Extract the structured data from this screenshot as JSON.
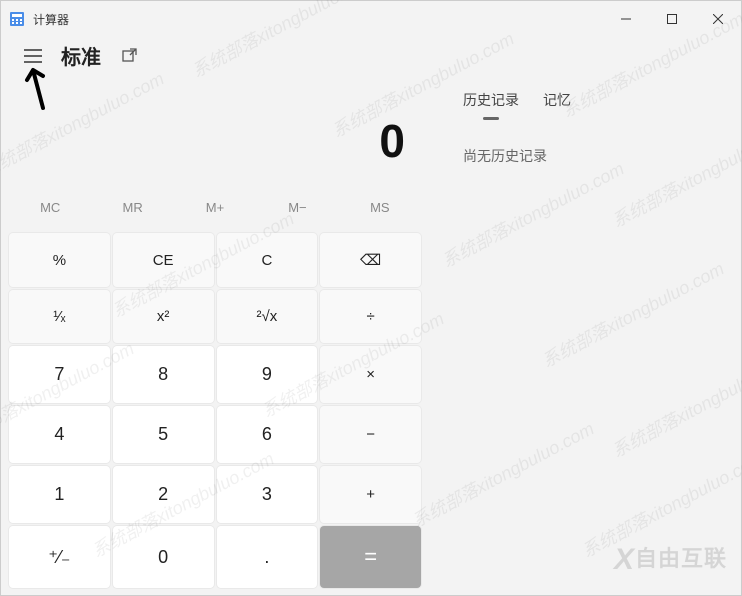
{
  "titlebar": {
    "title": "计算器"
  },
  "header": {
    "mode": "标准"
  },
  "display": {
    "value": "0"
  },
  "memory": {
    "mc": "MC",
    "mr": "MR",
    "mplus": "M+",
    "mminus": "M−",
    "ms": "MS"
  },
  "keys": {
    "percent": "%",
    "ce": "CE",
    "c": "C",
    "backspace": "⌫",
    "reciprocal": "¹⁄ₓ",
    "square": "x²",
    "sqrt": "²√x",
    "divide": "÷",
    "n7": "7",
    "n8": "8",
    "n9": "9",
    "multiply": "×",
    "n4": "4",
    "n5": "5",
    "n6": "6",
    "minus": "−",
    "n1": "1",
    "n2": "2",
    "n3": "3",
    "plus": "+",
    "negate": "⁺⁄₋",
    "n0": "0",
    "decimal": ".",
    "equals": "="
  },
  "history": {
    "tab_history": "历史记录",
    "tab_memory": "记忆",
    "empty_text": "尚无历史记录"
  },
  "watermark": "系统部落xitongbuluo.com",
  "brand": "自由互联"
}
